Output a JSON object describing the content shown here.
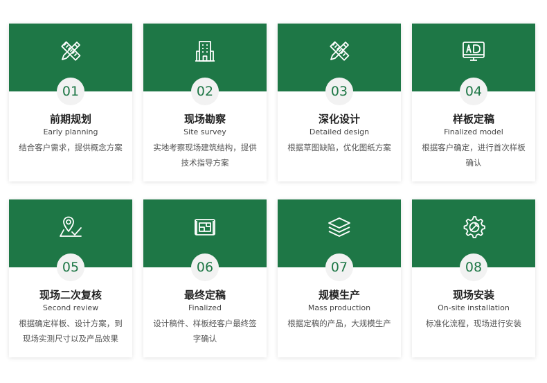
{
  "colors": {
    "accent": "#1e7746",
    "badge_bg": "#f2f2f2",
    "title": "#222222",
    "text": "#555555"
  },
  "steps": [
    {
      "icon": "pencil-ruler-icon",
      "number": "01",
      "title": "前期规划",
      "subtitle": "Early planning",
      "desc": "结合客户需求，提供概念方案"
    },
    {
      "icon": "building-icon",
      "number": "02",
      "title": "现场勘察",
      "subtitle": "Site survey",
      "desc": "实地考察现场建筑结构，提供技术指导方案"
    },
    {
      "icon": "pencil-ruler-icon",
      "number": "03",
      "title": "深化设计",
      "subtitle": "Detailed design",
      "desc": "根据草图缺陷，优化图纸方案"
    },
    {
      "icon": "ad-monitor-icon",
      "number": "04",
      "title": "样板定稿",
      "subtitle": "Finalized model",
      "desc": "根据客户确定，进行首次样板确认"
    },
    {
      "icon": "map-pin-check-icon",
      "number": "05",
      "title": "现场二次复核",
      "subtitle": "Second review",
      "desc": "根据确定样板、设计方案，到现场实测尺寸以及产品效果"
    },
    {
      "icon": "blueprint-icon",
      "number": "06",
      "title": "最终定稿",
      "subtitle": "Finalized",
      "desc": "设计稿件、样板经客户最终签字确认"
    },
    {
      "icon": "layers-icon",
      "number": "07",
      "title": "规模生产",
      "subtitle": "Mass production",
      "desc": "根据定稿的产品，大规模生产"
    },
    {
      "icon": "gear-wrench-icon",
      "number": "08",
      "title": "现场安装",
      "subtitle": "On-site installation",
      "desc": "标准化流程，现场进行安装"
    }
  ]
}
